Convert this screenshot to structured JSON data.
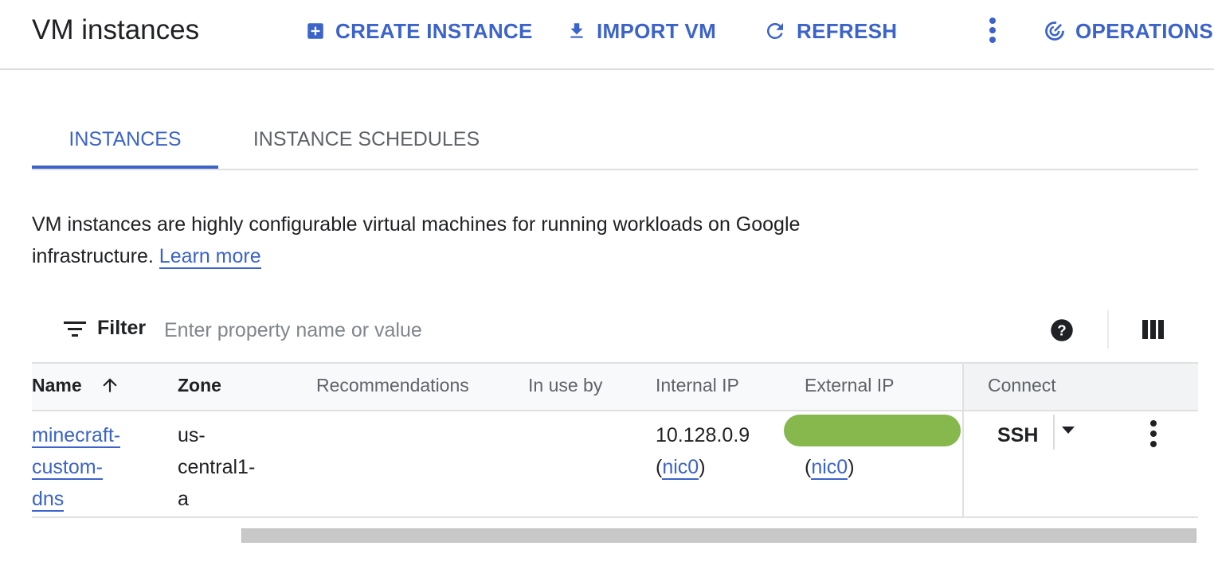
{
  "header": {
    "title": "VM instances",
    "actions": {
      "create": "CREATE INSTANCE",
      "import": "IMPORT VM",
      "refresh": "REFRESH",
      "operations": "OPERATIONS"
    }
  },
  "tabs": [
    {
      "label": "INSTANCES",
      "active": true
    },
    {
      "label": "INSTANCE SCHEDULES",
      "active": false
    }
  ],
  "description": {
    "text": "VM instances are highly configurable virtual machines for running workloads on Google infrastructure.",
    "link": "Learn more"
  },
  "filter": {
    "label": "Filter",
    "placeholder": "Enter property name or value"
  },
  "table": {
    "columns": {
      "name": "Name",
      "zone": "Zone",
      "recommendations": "Recommendations",
      "in_use_by": "In use by",
      "internal_ip": "Internal IP",
      "external_ip": "External IP",
      "connect": "Connect"
    },
    "sort": {
      "column": "Name",
      "direction": "ascending"
    },
    "rows": [
      {
        "name_lines": [
          "minecraft-",
          "custom-",
          "dns"
        ],
        "zone_lines": [
          "us-",
          "central1-",
          "a"
        ],
        "recommendations": "",
        "in_use_by": "",
        "internal_ip": "10.128.0.9",
        "internal_nic": "nic0",
        "external_ip_redacted": true,
        "external_nic": "nic0",
        "connect": "SSH"
      }
    ]
  },
  "icons": {
    "create": "add-box-icon",
    "import": "download-icon",
    "refresh": "refresh-icon",
    "operations": "operations-icon",
    "more": "more-vert-icon",
    "filter": "filter-list-icon",
    "help": "help-icon",
    "columns": "column-display-icon",
    "sort": "arrow-up-icon",
    "caret": "arrow-drop-down-icon"
  },
  "colors": {
    "accent": "#3b63c9",
    "redaction": "#87b84e",
    "text": "#202124",
    "muted": "#5f6368"
  }
}
